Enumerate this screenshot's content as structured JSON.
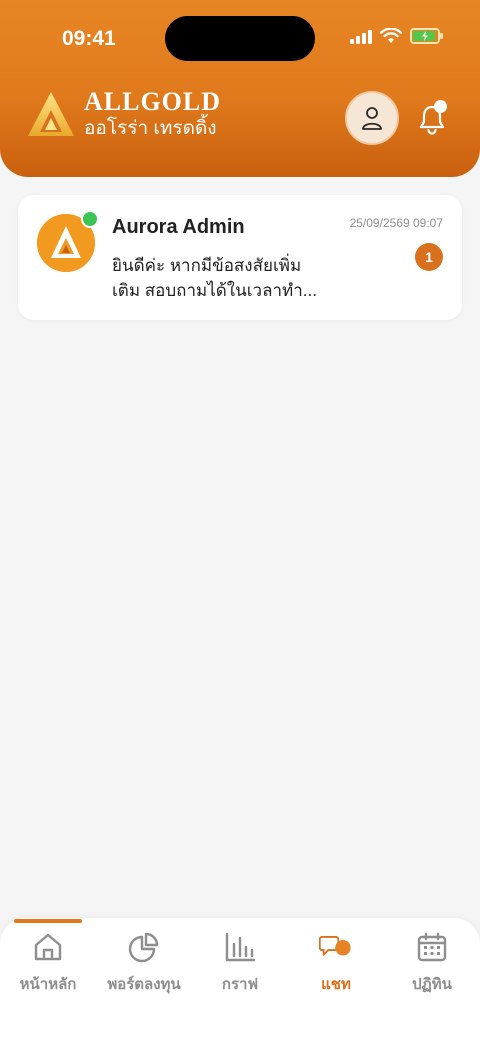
{
  "status_bar": {
    "time": "09:41"
  },
  "header": {
    "brand_name": "ALLGOLD",
    "brand_subtitle": "ออโรร่า เทรดดิ้ง"
  },
  "chats": [
    {
      "name": "Aurora Admin",
      "timestamp": "25/09/2569 09:07",
      "preview_line1": "ยินดีค่ะ หากมีข้อสงสัยเพิ่ม",
      "preview_line2": "เติม สอบถามได้ในเวลาทำ...",
      "unread_count": "1",
      "online": true
    }
  ],
  "tabs": [
    {
      "label": "หน้าหลัก",
      "icon": "home-icon"
    },
    {
      "label": "พอร์ตลงทุน",
      "icon": "pie-chart-icon"
    },
    {
      "label": "กราฟ",
      "icon": "bar-chart-icon"
    },
    {
      "label": "แชท",
      "icon": "chat-icon",
      "active": true
    },
    {
      "label": "ปฏิทิน",
      "icon": "calendar-icon"
    }
  ],
  "colors": {
    "accent": "#e07a1c",
    "header_dark": "#c9600f",
    "online": "#3cc553",
    "inactive": "#8e8e8e"
  }
}
